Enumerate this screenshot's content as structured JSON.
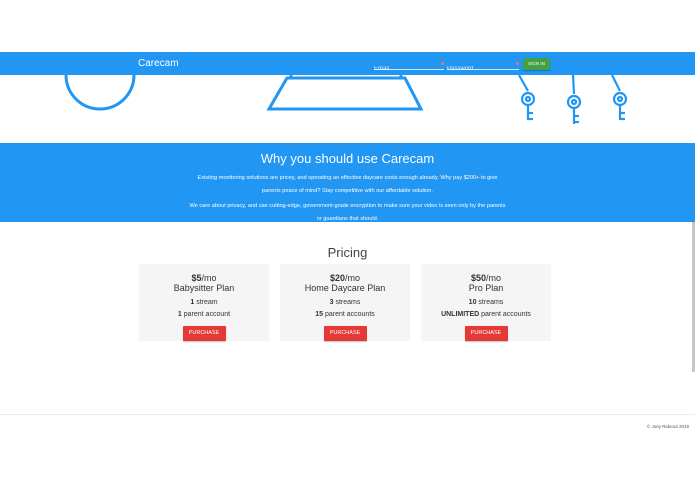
{
  "navbar": {
    "brand": "Carecam",
    "email_placeholder": "Email",
    "password_placeholder": "Password",
    "signin_label": "SIGN IN"
  },
  "colors": {
    "primary": "#2196f3",
    "signin": "#43a047",
    "purchase": "#e53935",
    "card_bg": "#f5f5f5"
  },
  "why": {
    "title": "Why you should use Carecam",
    "paragraph1_line1": "Existing monitoring solutions are pricey, and operating an effective daycare costs enough already. Why pay $200+ to give",
    "paragraph1_line2": "parents peace of mind? Stay competitive with our affordable solution.",
    "paragraph2_line1": "We care about privacy, and use cutting-edge, government-grade encryption to make sure your video is seen only by the parents",
    "paragraph2_line2": "or guardians that should."
  },
  "pricing": {
    "title": "Pricing",
    "plans": [
      {
        "price": "$5",
        "unit": "/mo",
        "name": "Babysitter Plan",
        "streams_count": "1",
        "streams_label": " stream",
        "accounts_count": "1",
        "accounts_label": " parent account",
        "button": "PURCHASE"
      },
      {
        "price": "$20",
        "unit": "/mo",
        "name": "Home Daycare Plan",
        "streams_count": "3",
        "streams_label": " streams",
        "accounts_count": "15",
        "accounts_label": " parent accounts",
        "button": "PURCHASE"
      },
      {
        "price": "$50",
        "unit": "/mo",
        "name": "Pro Plan",
        "streams_count": "10",
        "streams_label": " streams",
        "accounts_count": "UNLIMITED",
        "accounts_label": " parent accounts",
        "button": "PURCHASE"
      }
    ]
  },
  "footer": {
    "copyright": "© Joey Rideout 2019"
  }
}
